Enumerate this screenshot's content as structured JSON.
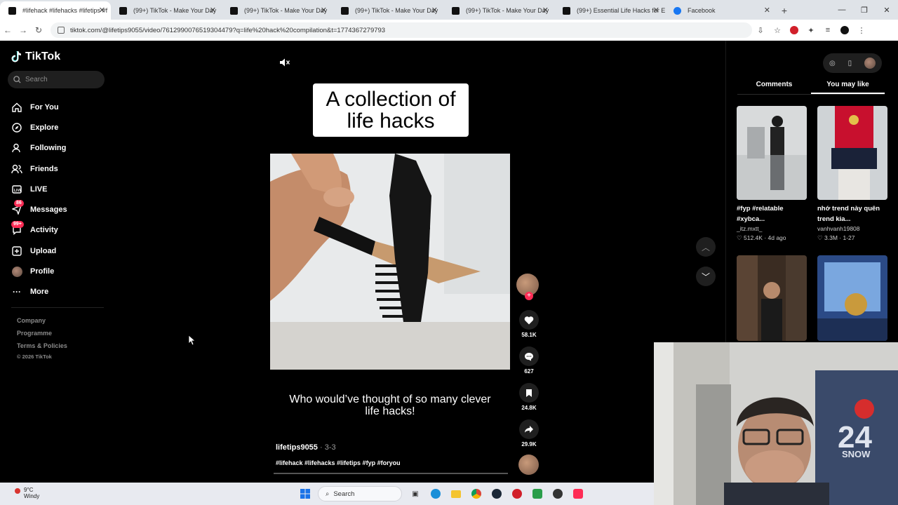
{
  "browser": {
    "tabs": [
      {
        "label": "#lifehack #lifehacks #lifetips #f",
        "active": true,
        "icon": "tiktok-icon"
      },
      {
        "label": "(99+) TikTok - Make Your Day",
        "icon": "tiktok-icon"
      },
      {
        "label": "(99+) TikTok - Make Your Day",
        "icon": "tiktok-icon"
      },
      {
        "label": "(99+) TikTok - Make Your Day",
        "icon": "tiktok-icon"
      },
      {
        "label": "(99+) TikTok - Make Your Day",
        "icon": "tiktok-icon"
      },
      {
        "label": "(99+) Essential Life Hacks for Ev",
        "icon": "tiktok-icon"
      },
      {
        "label": "Facebook",
        "icon": "facebook-icon"
      }
    ],
    "url": "tiktok.com/@lifetips9055/video/7612990076519304479?q=life%20hack%20compilation&t=1774367279793"
  },
  "sidebar": {
    "logo": "TikTok",
    "search_placeholder": "Search",
    "nav": [
      {
        "label": "For You",
        "icon": "home-icon"
      },
      {
        "label": "Explore",
        "icon": "compass-icon"
      },
      {
        "label": "Following",
        "icon": "following-icon"
      },
      {
        "label": "Friends",
        "icon": "friends-icon"
      },
      {
        "label": "LIVE",
        "icon": "live-icon"
      },
      {
        "label": "Messages",
        "icon": "messages-icon",
        "badge": "86"
      },
      {
        "label": "Activity",
        "icon": "activity-icon",
        "badge": "99+"
      },
      {
        "label": "Upload",
        "icon": "upload-icon"
      },
      {
        "label": "Profile",
        "icon": "profile-avatar"
      },
      {
        "label": "More",
        "icon": "more-icon"
      }
    ],
    "footer": [
      "Company",
      "Programme",
      "Terms & Policies"
    ],
    "copyright": "© 2026 TikTok"
  },
  "video": {
    "overlay_title": "A collection of life hacks",
    "caption": "Who would’ve thought of so many clever life hacks!",
    "author": "lifetips9055",
    "date": "· 3-3",
    "hashtags": "#lifehack #lifehacks #lifetips #fyp #foryou",
    "likes": "58.1K",
    "comments": "627",
    "saves": "24.8K",
    "shares": "29.9K"
  },
  "right_panel": {
    "tabs": [
      "Comments",
      "You may like"
    ],
    "active_tab": "You may like",
    "cards": [
      {
        "title": "#fyp #relatable #xybca...",
        "user": "_itz.mxtt_",
        "likes": "512.4K",
        "age": "4d ago"
      },
      {
        "title": "nhớ trend này quên trend kia...",
        "user": "vanhvanh19808",
        "likes": "3.3M",
        "age": "1-27"
      }
    ]
  },
  "taskbar": {
    "temperature": "9°C",
    "weather": "Windy",
    "search_label": "Search"
  },
  "colors": {
    "accent": "#fe2c55",
    "background": "#000000"
  }
}
